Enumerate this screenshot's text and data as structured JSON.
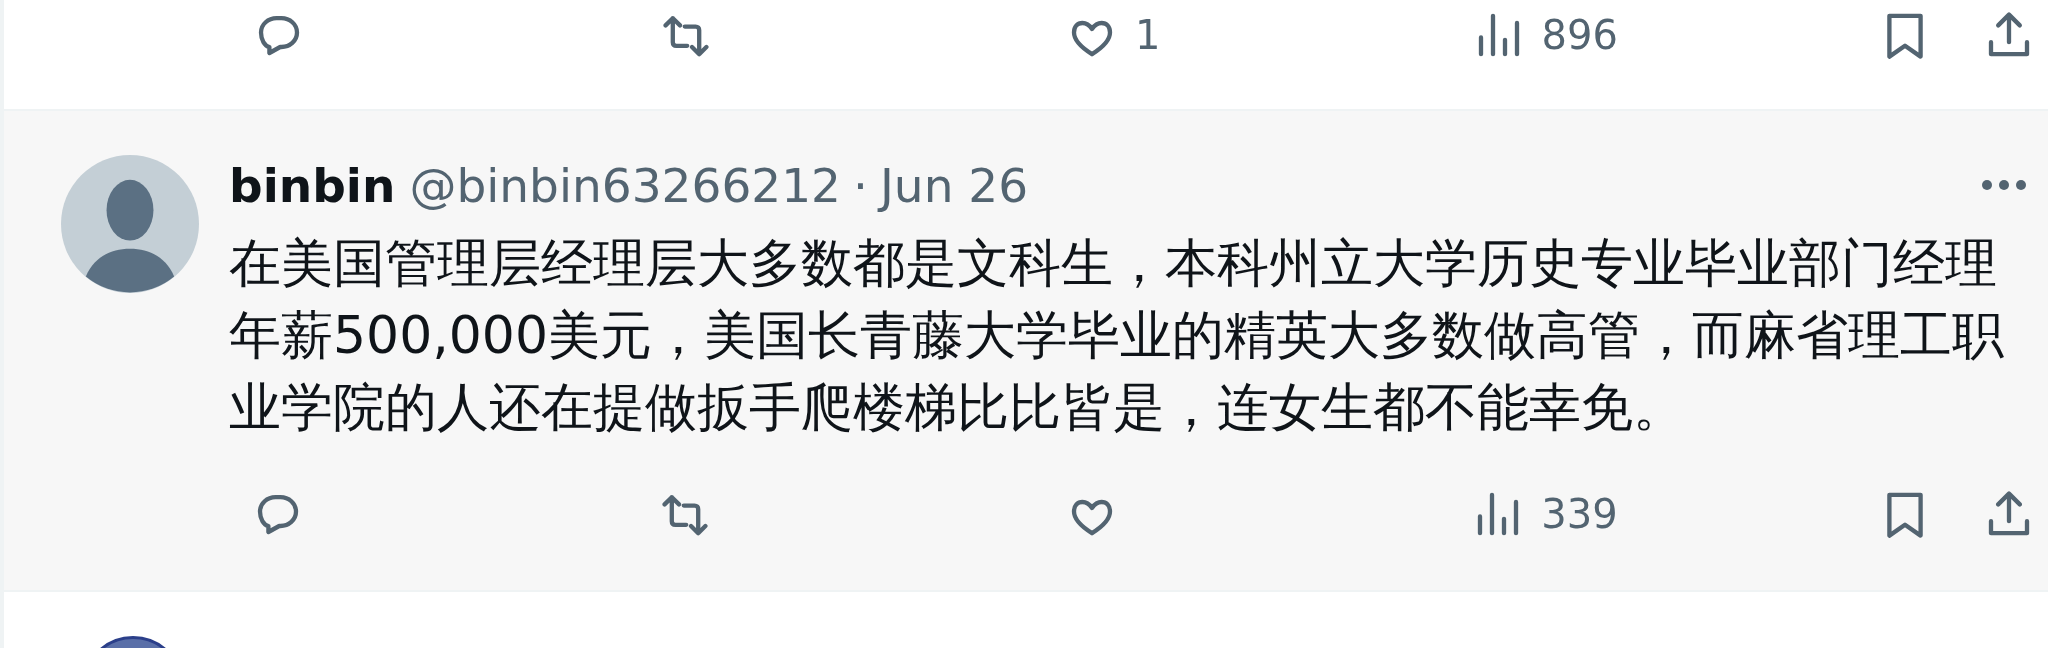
{
  "posts": [
    {
      "kind": "actions_only",
      "actions": [
        {
          "kind": "reply"
        },
        {
          "kind": "repost"
        },
        {
          "kind": "like",
          "count": "1"
        },
        {
          "kind": "views",
          "count": "896"
        },
        {
          "kind": "bookmark"
        },
        {
          "kind": "share"
        }
      ]
    },
    {
      "kind": "full",
      "name": "binbin",
      "handle": "@binbin63266212",
      "separator": "·",
      "date": "Jun 26",
      "text_lines": [
        "在美国管理层经理层大多数都是文科生，本科州立大学历史专业毕业部门经理",
        "年薪500,000美元，美国长青藤大学毕业的精英大多数做高管，而麻省理工职",
        "业学院的人还在提做扳手爬楼梯比比皆是，连女生都不能幸免。"
      ],
      "actions": [
        {
          "kind": "reply"
        },
        {
          "kind": "repost"
        },
        {
          "kind": "like"
        },
        {
          "kind": "views",
          "count": "339"
        },
        {
          "kind": "bookmark"
        },
        {
          "kind": "share"
        }
      ]
    },
    {
      "kind": "avatar_only"
    }
  ]
}
